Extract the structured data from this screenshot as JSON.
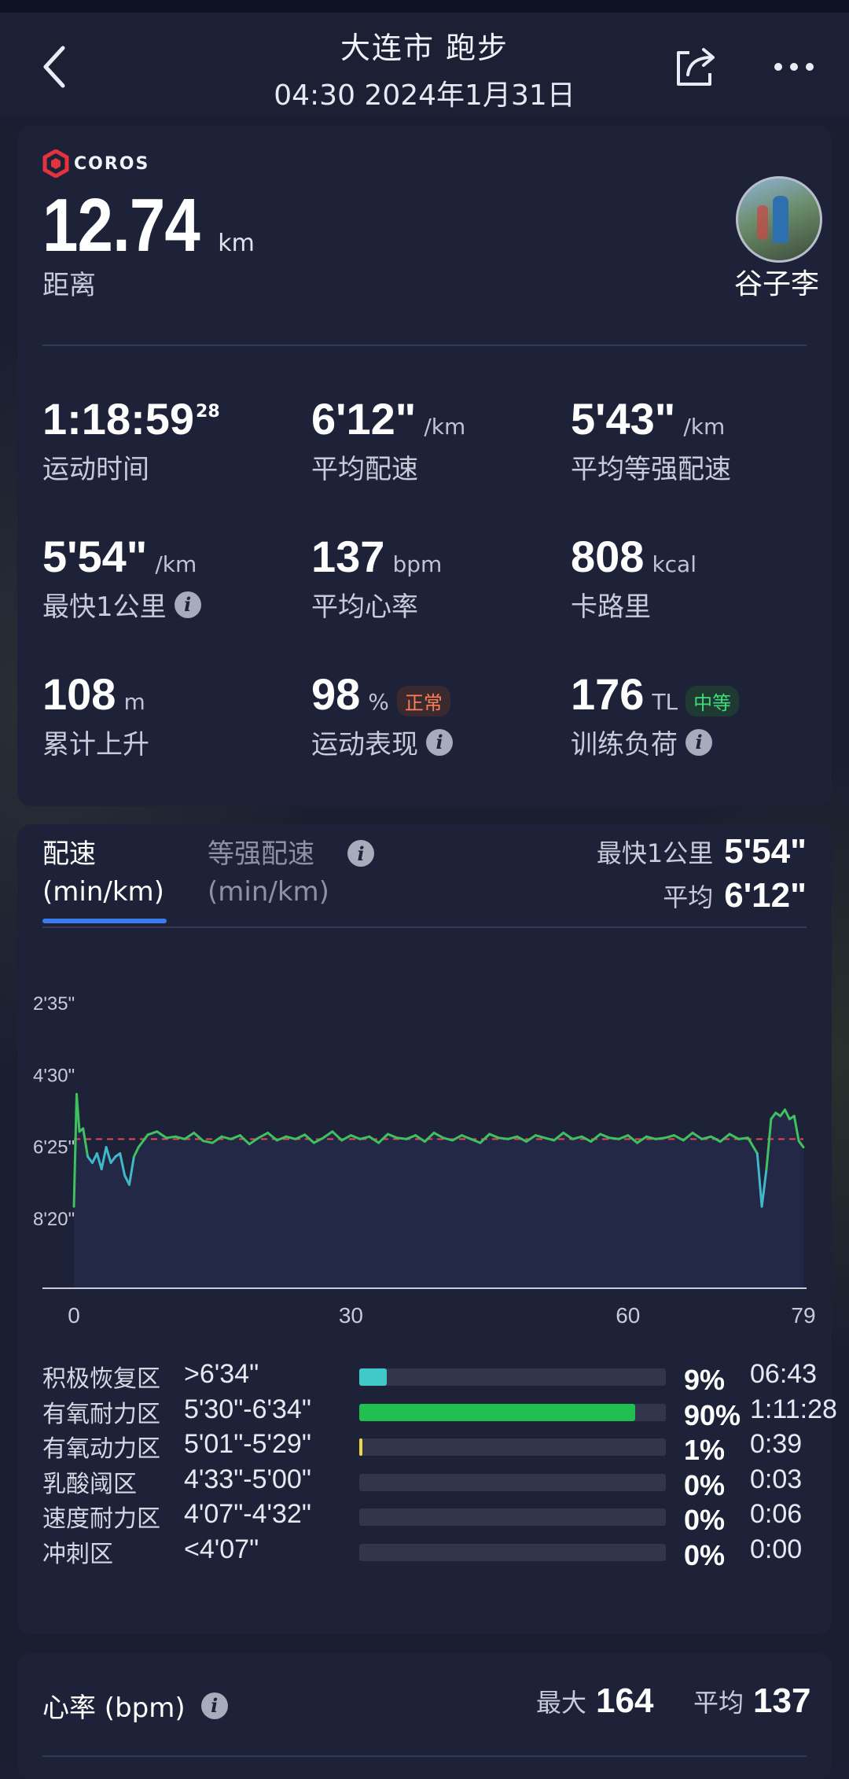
{
  "header": {
    "title": "大连市 跑步",
    "subtitle": "04:30 2024年1月31日"
  },
  "summary": {
    "brand": "COROS",
    "distance_value": "12.74",
    "distance_unit": "km",
    "distance_label": "距离",
    "user_name": "谷子李"
  },
  "stats": [
    {
      "value": "1:18:59",
      "sup": "28",
      "unit": "",
      "label": "运动时间"
    },
    {
      "value": "6'12\"",
      "unit": "/km",
      "label": "平均配速"
    },
    {
      "value": "5'43\"",
      "unit": "/km",
      "label": "平均等强配速"
    },
    {
      "value": "5'54\"",
      "unit": "/km",
      "label": "最快1公里"
    },
    {
      "value": "137",
      "unit": "bpm",
      "label": "平均心率"
    },
    {
      "value": "808",
      "unit": "kcal",
      "label": "卡路里"
    },
    {
      "value": "108",
      "unit": "m",
      "label": "累计上升"
    },
    {
      "value": "98",
      "unit": "%",
      "label": "运动表现",
      "badge": "正常"
    },
    {
      "value": "176",
      "unit": "TL",
      "label": "训练负荷",
      "badge": "中等"
    }
  ],
  "pace": {
    "tab_active_line1": "配速",
    "tab_active_line2": "(min/km)",
    "tab_other_line1": "等强配速",
    "tab_other_line2": "(min/km)",
    "fastest_label": "最快1公里",
    "fastest_value": "5'54\"",
    "avg_label": "平均",
    "avg_value": "6'12\""
  },
  "chart_data": {
    "type": "line",
    "y_ticks": [
      "2'35\"",
      "4'30\"",
      "6'25\"",
      "8'20\""
    ],
    "x_ticks": [
      "0",
      "30",
      "60",
      "79"
    ],
    "y_reversed": true,
    "x_range": [
      0,
      79
    ],
    "y_range_sec": [
      155,
      500
    ],
    "avg_line_sec": 372,
    "series_colors": {
      "normal": "#3fc25e",
      "slow": "#3fb9c9",
      "fast": "#f0d84a",
      "avg": "#e3474f"
    },
    "x": [
      0,
      0.3,
      0.6,
      1,
      1.5,
      2,
      2.5,
      3,
      3.5,
      4,
      4.5,
      5,
      5.5,
      6,
      6.5,
      7,
      8,
      9,
      10,
      11,
      12,
      13,
      14,
      15,
      16,
      17,
      18,
      19,
      20,
      21,
      22,
      23,
      24,
      25,
      26,
      27,
      28,
      29,
      30,
      31,
      32,
      33,
      34,
      35,
      36,
      37,
      38,
      39,
      40,
      41,
      42,
      43,
      44,
      45,
      46,
      47,
      48,
      49,
      50,
      51,
      52,
      53,
      54,
      55,
      56,
      57,
      58,
      59,
      60,
      61,
      62,
      63,
      64,
      65,
      66,
      67,
      68,
      69,
      70,
      71,
      72,
      73,
      74,
      74.5,
      75,
      75.5,
      76,
      76.5,
      77,
      77.5,
      78,
      78.5,
      79
    ],
    "y_sec": [
      480,
      300,
      360,
      355,
      400,
      410,
      395,
      420,
      385,
      410,
      400,
      395,
      430,
      445,
      400,
      385,
      365,
      360,
      370,
      368,
      372,
      362,
      375,
      378,
      368,
      372,
      366,
      380,
      370,
      362,
      374,
      368,
      372,
      365,
      378,
      370,
      360,
      374,
      366,
      372,
      368,
      378,
      364,
      370,
      372,
      366,
      376,
      362,
      370,
      374,
      366,
      372,
      378,
      364,
      370,
      372,
      368,
      376,
      366,
      370,
      374,
      362,
      372,
      368,
      376,
      364,
      370,
      372,
      366,
      378,
      368,
      372,
      370,
      366,
      374,
      362,
      372,
      368,
      376,
      364,
      372,
      370,
      395,
      480,
      420,
      340,
      330,
      335,
      325,
      340,
      335,
      375,
      385
    ]
  },
  "zones": [
    {
      "name": "积极恢复区",
      "range": ">6'34\"",
      "pct_value": 0.09,
      "pct": "9%",
      "time": "06:43",
      "color": "#3fc9c9"
    },
    {
      "name": "有氧耐力区",
      "range": "5'30\"-6'34\"",
      "pct_value": 0.9,
      "pct": "90%",
      "time": "1:11:28",
      "color": "#1fc04f"
    },
    {
      "name": "有氧动力区",
      "range": "5'01\"-5'29\"",
      "pct_value": 0.01,
      "pct": "1%",
      "time": "0:39",
      "color": "#f0d84a"
    },
    {
      "name": "乳酸阈区",
      "range": "4'33\"-5'00\"",
      "pct_value": 0,
      "pct": "0%",
      "time": "0:03",
      "color": "#f09a3a"
    },
    {
      "name": "速度耐力区",
      "range": "4'07\"-4'32\"",
      "pct_value": 0,
      "pct": "0%",
      "time": "0:06",
      "color": "#f06a3a"
    },
    {
      "name": "冲刺区",
      "range": "<4'07\"",
      "pct_value": 0,
      "pct": "0%",
      "time": "0:00",
      "color": "#e3474f"
    }
  ],
  "heart_rate": {
    "title": "心率 (bpm)",
    "max_label": "最大",
    "max_value": "164",
    "avg_label": "平均",
    "avg_value": "137"
  }
}
